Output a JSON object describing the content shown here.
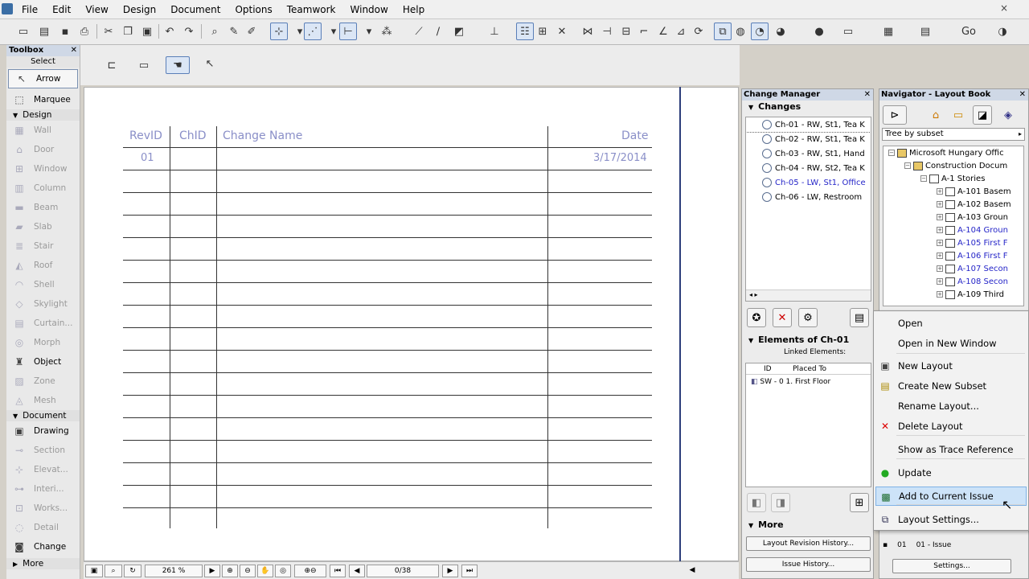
{
  "menu": [
    "File",
    "Edit",
    "View",
    "Design",
    "Document",
    "Options",
    "Teamwork",
    "Window",
    "Help"
  ],
  "window_close": "×",
  "toolbox": {
    "title": "Toolbox",
    "select_label": "Select",
    "tools_select": [
      {
        "label": "Arrow",
        "icon": "arrow-icon"
      },
      {
        "label": "Marquee",
        "icon": "marquee-icon"
      }
    ],
    "design_group": "Design",
    "tools_design": [
      {
        "label": "Wall",
        "icon": "wall-icon"
      },
      {
        "label": "Door",
        "icon": "door-icon"
      },
      {
        "label": "Window",
        "icon": "window-icon"
      },
      {
        "label": "Column",
        "icon": "column-icon"
      },
      {
        "label": "Beam",
        "icon": "beam-icon"
      },
      {
        "label": "Slab",
        "icon": "slab-icon"
      },
      {
        "label": "Stair",
        "icon": "stair-icon"
      },
      {
        "label": "Roof",
        "icon": "roof-icon"
      },
      {
        "label": "Shell",
        "icon": "shell-icon"
      },
      {
        "label": "Skylight",
        "icon": "skylight-icon"
      },
      {
        "label": "Curtain...",
        "icon": "curtain-wall-icon"
      },
      {
        "label": "Morph",
        "icon": "morph-icon"
      },
      {
        "label": "Object",
        "icon": "object-icon"
      },
      {
        "label": "Zone",
        "icon": "zone-icon"
      },
      {
        "label": "Mesh",
        "icon": "mesh-icon"
      }
    ],
    "document_group": "Document",
    "tools_document": [
      {
        "label": "Drawing",
        "icon": "drawing-icon"
      },
      {
        "label": "Section",
        "icon": "section-icon"
      },
      {
        "label": "Elevat...",
        "icon": "elevation-icon"
      },
      {
        "label": "Interi...",
        "icon": "interior-elevation-icon"
      },
      {
        "label": "Works...",
        "icon": "worksheet-icon"
      },
      {
        "label": "Detail",
        "icon": "detail-icon"
      },
      {
        "label": "Change",
        "icon": "change-icon"
      }
    ],
    "more_label": "More"
  },
  "table": {
    "headers": {
      "rev": "RevID",
      "chid": "ChID",
      "name": "Change Name",
      "date": "Date"
    },
    "rows": [
      {
        "rev": "01",
        "chid": "",
        "name": "",
        "date": "3/17/2014"
      }
    ]
  },
  "statusbar": {
    "zoom": "261 %",
    "page": "0/38"
  },
  "change_manager": {
    "title": "Change Manager",
    "changes_label": "Changes",
    "changes": [
      {
        "label": "Ch-01 - RW, St1, Tea K",
        "blue": false
      },
      {
        "label": "Ch-02 - RW, St1, Tea K",
        "blue": false
      },
      {
        "label": "Ch-03 - RW, St1, Hand",
        "blue": false
      },
      {
        "label": "Ch-04 - RW, St2, Tea K",
        "blue": false
      },
      {
        "label": "Ch-05 - LW, St1, Office",
        "blue": true
      },
      {
        "label": "Ch-06 - LW, Restroom",
        "blue": false
      }
    ],
    "elements_label": "Elements of Ch-01",
    "linked_label": "Linked Elements:",
    "col_id": "ID",
    "col_placed": "Placed To",
    "element_row": "SW - 0  1. First Floor",
    "more_label": "More",
    "btn_history": "Layout Revision History...",
    "btn_issue": "Issue History..."
  },
  "navigator": {
    "title": "Navigator - Layout Book",
    "tree_mode": "Tree by subset",
    "nodes": [
      {
        "label": "Microsoft Hungary Offic",
        "level": 0,
        "blue": false
      },
      {
        "label": "Construction Docum",
        "level": 1,
        "blue": false
      },
      {
        "label": "A-1 Stories",
        "level": 2,
        "blue": false
      },
      {
        "label": "A-101 Basem",
        "level": 3,
        "blue": false
      },
      {
        "label": "A-102 Basem",
        "level": 3,
        "blue": false
      },
      {
        "label": "A-103 Groun",
        "level": 3,
        "blue": false
      },
      {
        "label": "A-104 Groun",
        "level": 3,
        "blue": true
      },
      {
        "label": "A-105 First F",
        "level": 3,
        "blue": true
      },
      {
        "label": "A-106 First F",
        "level": 3,
        "blue": true
      },
      {
        "label": "A-107 Secon",
        "level": 3,
        "blue": true
      },
      {
        "label": "A-108 Secon",
        "level": 3,
        "blue": true
      },
      {
        "label": "A-109 Third",
        "level": 3,
        "blue": false
      }
    ],
    "issue_rev": "01",
    "issue_name": "01 - Issue",
    "settings_btn": "Settings..."
  },
  "context_menu": [
    {
      "label": "Open",
      "icon": ""
    },
    {
      "label": "Open in New Window",
      "icon": ""
    },
    {
      "label": "New Layout",
      "icon": "new-layout-icon"
    },
    {
      "label": "Create New Subset",
      "icon": "new-subset-icon"
    },
    {
      "label": "Rename Layout...",
      "icon": ""
    },
    {
      "label": "Delete Layout",
      "icon": "delete-icon"
    },
    {
      "label": "Show as Trace Reference",
      "icon": ""
    },
    {
      "label": "Update",
      "icon": "update-icon"
    },
    {
      "label": "Add to Current Issue",
      "icon": "add-to-issue-icon"
    },
    {
      "label": "Layout Settings...",
      "icon": "layout-settings-icon"
    }
  ]
}
